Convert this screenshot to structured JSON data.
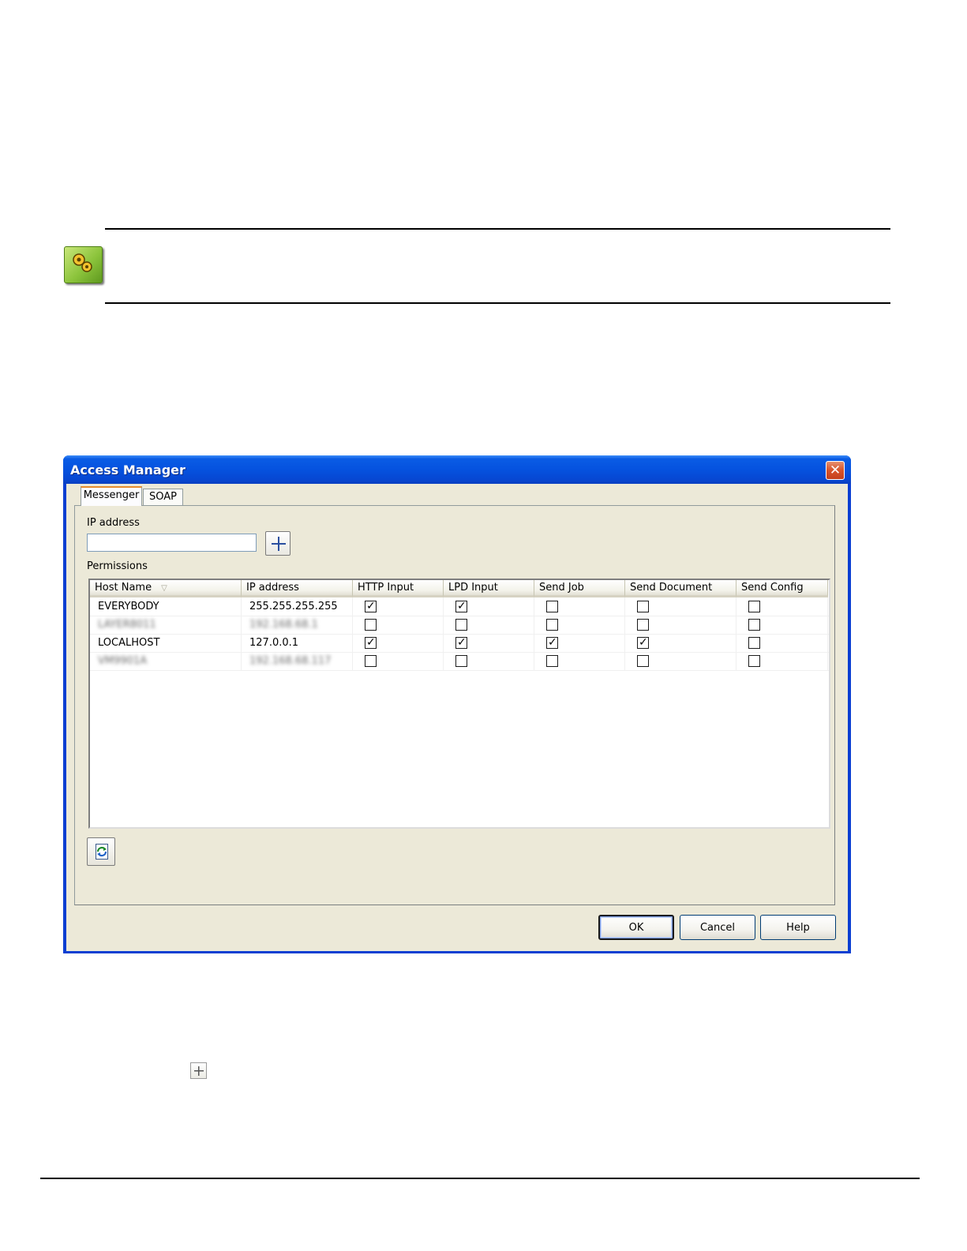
{
  "dialog": {
    "title": "Access Manager",
    "close_symbol": "✕",
    "tabs": [
      {
        "label": "Messenger",
        "active": true
      },
      {
        "label": "SOAP",
        "active": false
      }
    ],
    "ip_address_label": "IP address",
    "ip_address_value": "",
    "permissions_label": "Permissions",
    "columns": [
      "Host Name",
      "IP address",
      "HTTP Input",
      "LPD Input",
      "Send Job",
      "Send Document",
      "Send Config"
    ],
    "sort_icon": "▽",
    "rows": [
      {
        "host": "EVERYBODY",
        "ip": "255.255.255.255",
        "blurred": false,
        "perms": [
          true,
          true,
          false,
          false,
          false
        ]
      },
      {
        "host": "LAYER8011",
        "ip": "192.168.68.1",
        "blurred": true,
        "perms": [
          false,
          false,
          false,
          false,
          false
        ]
      },
      {
        "host": "LOCALHOST",
        "ip": "127.0.0.1",
        "blurred": false,
        "perms": [
          true,
          true,
          true,
          true,
          false
        ]
      },
      {
        "host": "VM9901A",
        "ip": "192.168.68.117",
        "blurred": true,
        "perms": [
          false,
          false,
          false,
          false,
          false
        ]
      }
    ],
    "buttons": {
      "ok": "OK",
      "cancel": "Cancel",
      "help": "Help"
    },
    "icons": {
      "add": "plus-icon",
      "refresh": "refresh-icon",
      "close": "close-icon"
    }
  },
  "colors": {
    "titlebar": "#0552df",
    "dialog_face": "#ece9d8",
    "close_button": "#d8532a",
    "note_icon": "#8cc43c"
  }
}
